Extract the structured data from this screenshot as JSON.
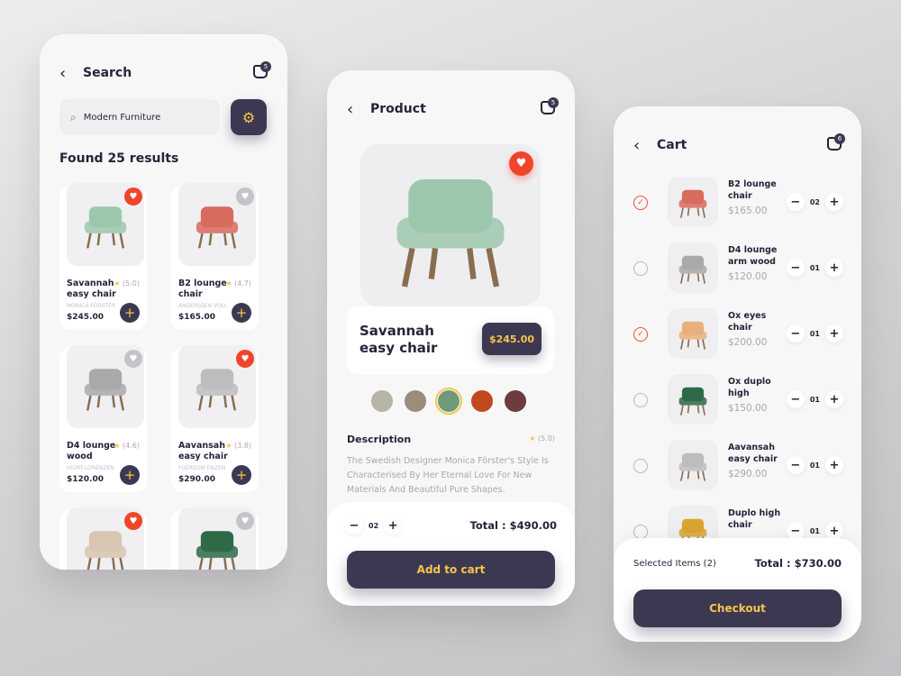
{
  "colors": {
    "accent": "#f6c54a",
    "primary": "#3d3852",
    "heart_active": "#f0452a",
    "heart_inactive": "#c4c4c8",
    "check": "#e8522f"
  },
  "search_screen": {
    "title": "Search",
    "cart_count": "5",
    "search_value": "Modern Furniture",
    "found": "Found 25 results",
    "products": [
      {
        "name": "Savannah easy chair",
        "rating": "(5.0)",
        "designer": "MONICA FÖRSTER",
        "price": "$245.00",
        "liked": true,
        "color": "#9cc7ad"
      },
      {
        "name": "B2 lounge chair",
        "rating": "(4.7)",
        "designer": "ANDERSSEN VOLL",
        "price": "$165.00",
        "liked": false,
        "color": "#d86a5e"
      },
      {
        "name": "D4 lounge wood",
        "rating": "(4.6)",
        "designer": "HIORT-LORENZEN",
        "price": "$120.00",
        "liked": false,
        "color": "#a9a9ab"
      },
      {
        "name": "Aavansah easy chair",
        "rating": "(3.8)",
        "designer": "FOERSOM ENZEN",
        "price": "$290.00",
        "liked": true,
        "color": "#bdbdc0"
      },
      {
        "name": "",
        "rating": "",
        "designer": "",
        "price": "",
        "liked": true,
        "color": "#d8c6b0"
      },
      {
        "name": "",
        "rating": "",
        "designer": "",
        "price": "",
        "liked": false,
        "color": "#2f6a48"
      }
    ]
  },
  "product_screen": {
    "title": "Product",
    "cart_count": "5",
    "name": "Savannah easy chair",
    "price": "$245.00",
    "liked": true,
    "swatches": [
      "#b7b3a7",
      "#9c8c7a",
      "#6f9a78",
      "#c2481e",
      "#6d3c40"
    ],
    "selected_swatch": 2,
    "description_title": "Description",
    "rating": "(5.0)",
    "description": "The Swedish Designer Monica Förster's Style Is Characterised By Her Eternal Love For New Materials And Beautiful Pure Shapes.",
    "quantity": "02",
    "total_label": "Total :",
    "total": "$490.00",
    "add_to_cart": "Add to cart"
  },
  "cart_screen": {
    "title": "Cart",
    "cart_count": "6",
    "items": [
      {
        "name": "B2 lounge chair",
        "price": "$165.00",
        "qty": "02",
        "selected": true,
        "color": "#d86a5e"
      },
      {
        "name": "D4 lounge arm wood",
        "price": "$120.00",
        "qty": "01",
        "selected": false,
        "color": "#a9a9ab"
      },
      {
        "name": "Ox eyes chair",
        "price": "$200.00",
        "qty": "01",
        "selected": true,
        "color": "#e9b07e"
      },
      {
        "name": "Ox duplo high",
        "price": "$150.00",
        "qty": "01",
        "selected": false,
        "color": "#2f6a48"
      },
      {
        "name": "Aavansah easy chair",
        "price": "$290.00",
        "qty": "01",
        "selected": false,
        "color": "#bdbdc0"
      },
      {
        "name": "Duplo high chair",
        "price": "",
        "qty": "01",
        "selected": false,
        "color": "#d9a431"
      }
    ],
    "selected_label": "Selected Items (2)",
    "total_label": "Total :",
    "total": "$730.00",
    "checkout": "Checkout"
  }
}
